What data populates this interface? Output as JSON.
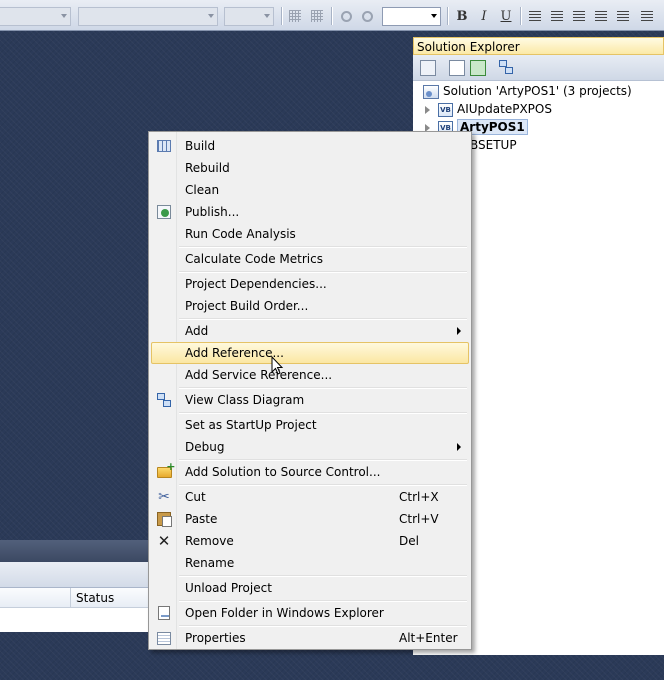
{
  "toolbar": {
    "combo_3_value": "",
    "bold": "B",
    "italic": "I",
    "underline": "U"
  },
  "solution_explorer": {
    "title": "Solution Explorer",
    "tree": [
      {
        "label": "Solution 'ArtyPOS1' (3 projects)"
      },
      {
        "label": "AIUpdatePXPOS"
      },
      {
        "label": "ArtyPOS1"
      },
      {
        "label": "BSETUP"
      }
    ]
  },
  "bottom_panel": {
    "status_header": "Status"
  },
  "context_menu": {
    "items": [
      {
        "label": "Build",
        "icon": "build-icon"
      },
      {
        "label": "Rebuild"
      },
      {
        "label": "Clean"
      },
      {
        "label": "Publish...",
        "icon": "publish-icon"
      },
      {
        "label": "Run Code Analysis"
      },
      {
        "label": "Calculate Code Metrics"
      },
      {
        "label": "Project Dependencies..."
      },
      {
        "label": "Project Build Order..."
      },
      {
        "label": "Add",
        "submenu": true
      },
      {
        "label": "Add Reference...",
        "highlighted": true
      },
      {
        "label": "Add Service Reference..."
      },
      {
        "label": "View Class Diagram",
        "icon": "class-diagram-icon"
      },
      {
        "label": "Set as StartUp Project"
      },
      {
        "label": "Debug",
        "submenu": true
      },
      {
        "label": "Add Solution to Source Control...",
        "icon": "folder-add-icon"
      },
      {
        "label": "Cut",
        "shortcut": "Ctrl+X",
        "icon": "scissors-icon"
      },
      {
        "label": "Paste",
        "shortcut": "Ctrl+V",
        "icon": "paste-icon"
      },
      {
        "label": "Remove",
        "shortcut": "Del",
        "icon": "remove-icon"
      },
      {
        "label": "Rename"
      },
      {
        "label": "Unload Project"
      },
      {
        "label": "Open Folder in Windows Explorer",
        "icon": "open-folder-icon"
      },
      {
        "label": "Properties",
        "shortcut": "Alt+Enter",
        "icon": "properties-icon"
      }
    ]
  },
  "colors": {
    "workspace_bg": "#2b3a58",
    "menu_bg": "#f0f0f0",
    "highlight": "#fbe7a3",
    "explorer_title": "#fbe9a6"
  }
}
